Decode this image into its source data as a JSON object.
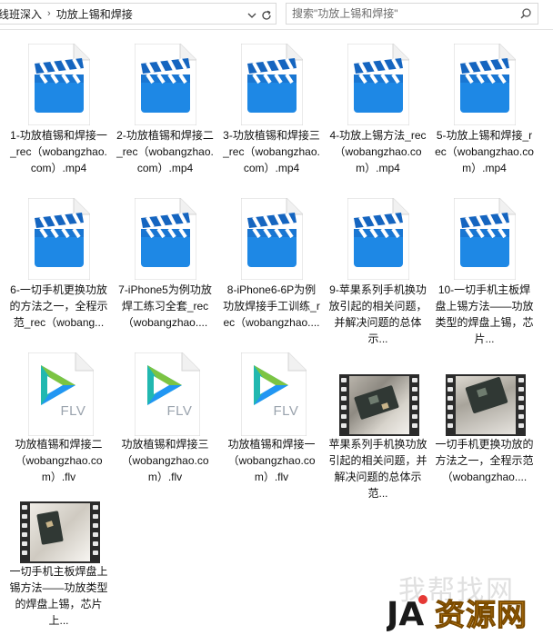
{
  "address_bar": {
    "crumbs": [
      "线班深入",
      "功放上锡和焊接"
    ],
    "separator": "›"
  },
  "search": {
    "placeholder": "搜索\"功放上锡和焊接\""
  },
  "files": [
    {
      "label": "1-功放植锡和焊接一_rec（wobangzhao.com）.mp4",
      "icon": "video-file-icon"
    },
    {
      "label": "2-功放植锡和焊接二_rec（wobangzhao.com）.mp4",
      "icon": "video-file-icon"
    },
    {
      "label": "3-功放植锡和焊接三_rec（wobangzhao.com）.mp4",
      "icon": "video-file-icon"
    },
    {
      "label": "4-功放上锡方法_rec（wobangzhao.com）.mp4",
      "icon": "video-file-icon"
    },
    {
      "label": "5-功放上锡和焊接_rec（wobangzhao.com）.mp4",
      "icon": "video-file-icon"
    },
    {
      "label": "6-一切手机更换功放的方法之一，全程示范_rec（wobang...",
      "icon": "video-file-icon"
    },
    {
      "label": "7-iPhone5为例功放焊工练习全套_rec（wobangzhao....",
      "icon": "video-file-icon"
    },
    {
      "label": "8-iPhone6-6P为例功放焊接手工训练_rec（wobangzhao....",
      "icon": "video-file-icon"
    },
    {
      "label": "9-苹果系列手机换功放引起的相关问题，并解决问题的总体示...",
      "icon": "video-file-icon"
    },
    {
      "label": "10-一切手机主板焊盘上锡方法——功放类型的焊盘上锡，芯片...",
      "icon": "video-file-icon"
    },
    {
      "label": "功放植锡和焊接二（wobangzhao.com）.flv",
      "icon": "flv-file-icon",
      "badge": "FLV"
    },
    {
      "label": "功放植锡和焊接三（wobangzhao.com）.flv",
      "icon": "flv-file-icon",
      "badge": "FLV"
    },
    {
      "label": "功放植锡和焊接一（wobangzhao.com）.flv",
      "icon": "flv-file-icon",
      "badge": "FLV"
    },
    {
      "label": "苹果系列手机换功放引起的相关问题，并解决问题的总体示范...",
      "icon": "video-thumbnail"
    },
    {
      "label": "一切手机更换功放的方法之一，全程示范（wobangzhao....",
      "icon": "video-thumbnail"
    },
    {
      "label": "一切手机主板焊盘上锡方法——功放类型的焊盘上锡，芯片上...",
      "icon": "video-thumbnail"
    }
  ],
  "watermark": {
    "text": "资源网",
    "logo_text": "JA"
  },
  "colors": {
    "clapper_blue": "#1e88e5",
    "clapper_dark": "#1565c0",
    "flv_teal": "#21b8b0",
    "flv_green": "#7cc443",
    "flv_blue": "#2196f3",
    "watermark_orange": "#f5a623"
  }
}
